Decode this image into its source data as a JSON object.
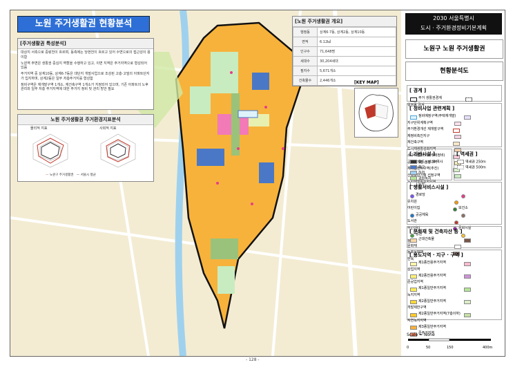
{
  "title": "노원 주거생활권 현황분석",
  "feature_panel": {
    "title": "[주거생활권 특성분석]",
    "bullets": [
      "대상지 서측으로 중랑천이 흐르며, 동측에는 당현천이 흐르고 있어 수변으로의 접근성이 용이함",
      "노원역 주변은 생활권 중심지 역할을 수행하고 있고, 이면 지역은 주거지역으로 형성되어 있음",
      "주거지역 중 상계10동, 상계6·7동은 대단지 개발사업으로 조성된 고층·고밀의 아파트단지가 입지하며, 상계2동은 일부 저층주거지를 형성함",
      "정비구역은 재개발구역 1개소, 재건축구역 1개소가 지정되어 있으며, 기존 아파트의 노후 관리와 일부 저층 주거지역에 대한 주거지 정비 및 관리 방안 필요"
    ]
  },
  "index_panel": {
    "title": "노원 주거생활권 주거환경지표분석",
    "subtitle": "[노원 주거생활권 주거환경지표분석]",
    "chart_left": "물리적 지표",
    "chart_right": "사회적 지표",
    "legend_a": "노원구 주거생활권",
    "legend_b": "서울시 평균"
  },
  "overview": {
    "title": "[노원 주거생활권 개요]",
    "rows": [
      {
        "k": "행정동",
        "v": "상계6·7동, 상계2동, 상계10동"
      },
      {
        "k": "면적",
        "v": "6.12㎢"
      },
      {
        "k": "인구수",
        "v": "71,648명"
      },
      {
        "k": "세대수",
        "v": "30,204세대"
      },
      {
        "k": "필지수",
        "v": "5,671개소"
      },
      {
        "k": "건축물수",
        "v": "2,446개소"
      }
    ]
  },
  "keymap_label": "[KEY MAP]",
  "side": {
    "head1": "2030 서울특별시",
    "head2": "도시 · 주거환경정비기본계획",
    "sub": "노원구 노원 주거생활권",
    "sub2": "현황분석도",
    "legends": [
      {
        "title": "[ 경계 ]",
        "items": [
          "주거 생활권경계",
          "행정동 경계"
        ]
      },
      {
        "title": "[ 정비사업 관련계획 ]",
        "items": [
          "정비예정구역(주택재개발)",
          "지구단위계획구역",
          "주거환경개선 재개발구역",
          "재정비촉진지구",
          "재건축구역",
          "도시재생활성화지역",
          "소규모정비(가로주택정비)",
          "공공재개발 선정구역",
          "재개발정비구역(추진)",
          "신속통합기획 선정구역",
          "도시재생활성화지역"
        ]
      },
      {
        "title": "[ 기반시설 ]",
        "items": [
          "철도노선 및 역사",
          "학교",
          "하천",
          "공원녹지",
          "도로"
        ]
      },
      {
        "title": "[ 역세권 ]",
        "items": [
          "역세권 250m",
          "역세권 500m"
        ]
      },
      {
        "title": "[ 생활서비스시설 ]",
        "items": [
          "경로당",
          "유치원",
          "어린이집",
          "보건소",
          "공공체육",
          "도서관",
          "주민센터",
          "문화시설",
          "공원",
          "놀이터"
        ]
      },
      {
        "title": "[ 문화재 및 건축자산 등 ]",
        "items": [
          "근대건축물",
          "문화재",
          "등록문화재",
          "한옥"
        ]
      },
      {
        "title": "[ 용도지역 · 지구 · 구역 ]",
        "items": [
          "제1종전용주거지역",
          "제2종전용주거지역",
          "제1종일반주거지역",
          "제2종일반주거지역",
          "제2종일반주거지역(7층이하)",
          "제3종일반주거지역",
          "준주거지역",
          "상업지역",
          "준공업지역",
          "녹지지역",
          "개발제한구역",
          "자연녹지지역"
        ]
      }
    ],
    "scale": "Scale = None",
    "scale_ticks": [
      "0",
      "50",
      "150",
      "400m"
    ]
  },
  "page_number": "- 128 -",
  "colors": {
    "title_bg": "#2d6fd6",
    "apartment": "#f5a623",
    "green": "#b6e59a",
    "boundary": "#111111",
    "school": "#4a78c6"
  }
}
